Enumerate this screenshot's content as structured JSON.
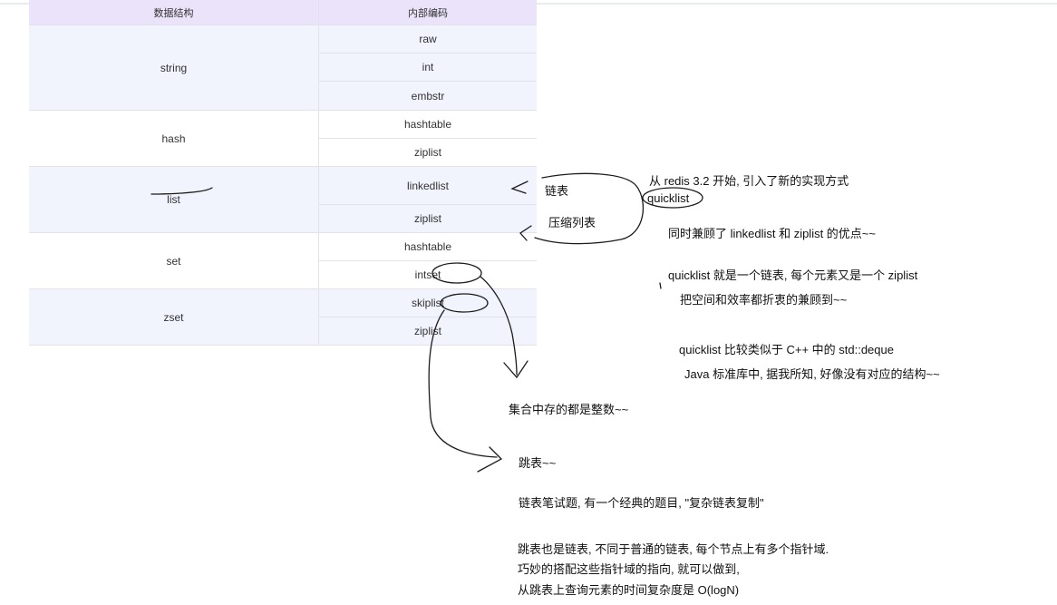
{
  "table": {
    "headers": [
      "数据结构",
      "内部编码"
    ],
    "groups": [
      {
        "name": "string",
        "encodings": [
          "raw",
          "int",
          "embstr"
        ]
      },
      {
        "name": "hash",
        "encodings": [
          "hashtable",
          "ziplist"
        ]
      },
      {
        "name": "list",
        "encodings": [
          "linkedlist",
          "ziplist"
        ]
      },
      {
        "name": "set",
        "encodings": [
          "hashtable",
          "intset"
        ]
      },
      {
        "name": "zset",
        "encodings": [
          "skiplist",
          "ziplist"
        ]
      }
    ]
  },
  "notes": {
    "linked_list_label": "链表",
    "ziplist_label": "压缩列表",
    "redis_line": "从 redis 3.2 开始, 引入了新的实现方式",
    "quicklist": "quicklist",
    "quicklist_1": "同时兼顾了 linkedlist 和 ziplist 的优点~~",
    "quicklist_2": "quicklist 就是一个链表, 每个元素又是一个 ziplist",
    "quicklist_3": "把空间和效率都折衷的兼顾到~~",
    "quicklist_4": "quicklist 比较类似于 C++ 中的 std::deque",
    "quicklist_5": "Java 标准库中, 据我所知, 好像没有对应的结构~~",
    "intset_note": "集合中存的都是整数~~",
    "skiplist_note": "跳表~~",
    "skiplist_1": "链表笔试题, 有一个经典的题目, \"复杂链表复制\"",
    "skiplist_2": "跳表也是链表, 不同于普通的链表, 每个节点上有多个指针域.",
    "skiplist_3": "巧妙的搭配这些指针域的指向, 就可以做到,",
    "skiplist_4": "从跳表上查询元素的时间复杂度是 O(logN)"
  }
}
